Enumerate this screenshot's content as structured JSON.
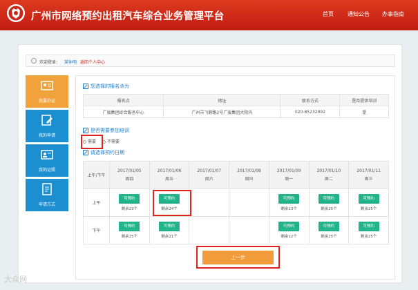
{
  "header": {
    "title": "广州市网络预约出租汽车综合业务管理平台",
    "nav": [
      "首页",
      "通知公告",
      "办事指南"
    ],
    "accent": "#c9261a"
  },
  "welcome": {
    "prefix": "欢迎登录：",
    "user": "某仲明",
    "back_link": "返回个人中心"
  },
  "sidebar": {
    "items": [
      {
        "label": "我要办证",
        "icon": "id-card-icon",
        "active": true
      },
      {
        "label": "我的申请",
        "icon": "edit-document-icon",
        "active": false
      },
      {
        "label": "我的证照",
        "icon": "license-card-icon",
        "active": false
      },
      {
        "label": "申请方式",
        "icon": "form-list-icon",
        "active": false
      }
    ]
  },
  "section1": {
    "title": "您选择的报名点为",
    "headers": [
      "报名点",
      "地址",
      "联系方式",
      "是否提供培训"
    ],
    "row": [
      "广骏集团综合服务中心",
      "广州市飞鹅路2号广骏集团大院内",
      "020-85232992",
      "是"
    ]
  },
  "section2": {
    "title": "是否需要参加培训",
    "options": [
      "需要",
      "不需要"
    ],
    "selected": "需要"
  },
  "section3": {
    "title": "请选择预约日期",
    "corner": "上午/下午",
    "days": [
      {
        "date": "2017/01/05",
        "week": "周四"
      },
      {
        "date": "2017/01/06",
        "week": "周五"
      },
      {
        "date": "2017/01/07",
        "week": "周六"
      },
      {
        "date": "2017/01/08",
        "week": "周日"
      },
      {
        "date": "2017/01/09",
        "week": "周一"
      },
      {
        "date": "2017/01/10",
        "week": "周二"
      },
      {
        "date": "2017/01/11",
        "week": "周三"
      }
    ],
    "rows": [
      {
        "label": "上午",
        "slots": [
          {
            "btn": "可预约",
            "remain": "剩余23个"
          },
          {
            "btn": "可预约",
            "remain": "剩余24个"
          },
          null,
          null,
          {
            "btn": "可预约",
            "remain": "剩余13个"
          },
          {
            "btn": "可预约",
            "remain": "剩余25个"
          },
          {
            "btn": "可预约",
            "remain": "剩余25个"
          }
        ]
      },
      {
        "label": "下午",
        "slots": [
          {
            "btn": "可预约",
            "remain": "剩余25个"
          },
          {
            "btn": "可预约",
            "remain": "剩余21个"
          },
          null,
          null,
          {
            "btn": "可预约",
            "remain": "剩余12个"
          },
          {
            "btn": "可预约",
            "remain": "剩余25个"
          },
          {
            "btn": "可预约",
            "remain": "剩余25个"
          }
        ]
      }
    ]
  },
  "buttons": {
    "prev": "上一步"
  },
  "watermark": "大众网"
}
